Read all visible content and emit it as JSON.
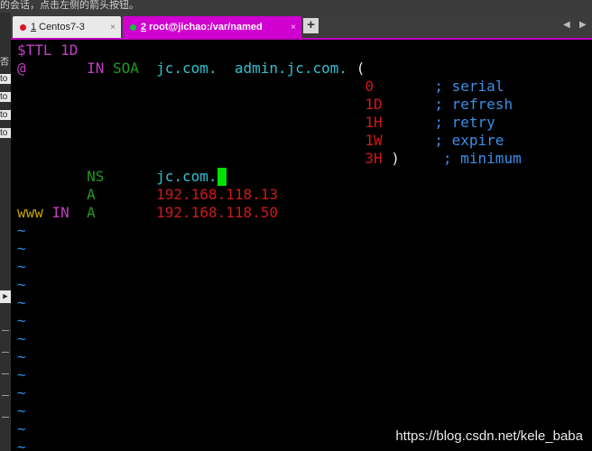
{
  "app_top_text": "的会话，点击左侧的箭头按钮。",
  "left_panel": {
    "items": [
      "否",
      "to",
      "to",
      "to",
      "to"
    ]
  },
  "tabs": [
    {
      "number": "1",
      "label": "Centos7-3",
      "status_color": "#e0102a",
      "active": false,
      "close": "×"
    },
    {
      "number": "2",
      "label": "root@jichao:/var/named",
      "status_color": "#17c13a",
      "active": true,
      "close": "×"
    }
  ],
  "add_tab_label": "+",
  "tab_nav": {
    "prev": "◀",
    "next": "▶"
  },
  "editor": {
    "lines": [
      {
        "segments": [
          {
            "text": "$TTL 1D",
            "color": "pink"
          }
        ]
      },
      {
        "segments": [
          {
            "text": "@",
            "color": "pink"
          },
          {
            "text": "       IN ",
            "color": "pink"
          },
          {
            "text": "SOA",
            "color": "green"
          },
          {
            "text": "  jc.com.  admin.jc.com. ",
            "color": "cyan"
          },
          {
            "text": "(",
            "color": "white"
          }
        ]
      },
      {
        "segments": [
          {
            "text": "                                        0",
            "color": "red"
          },
          {
            "text": "       ; serial",
            "color": "blue"
          }
        ]
      },
      {
        "segments": [
          {
            "text": "                                        1D",
            "color": "red"
          },
          {
            "text": "      ; refresh",
            "color": "blue"
          }
        ]
      },
      {
        "segments": [
          {
            "text": "                                        1H",
            "color": "red"
          },
          {
            "text": "      ; retry",
            "color": "blue"
          }
        ]
      },
      {
        "segments": [
          {
            "text": "                                        1W",
            "color": "red"
          },
          {
            "text": "      ; expire",
            "color": "blue"
          }
        ]
      },
      {
        "segments": [
          {
            "text": "                                        3H",
            "color": "red"
          },
          {
            "text": " )",
            "color": "white"
          },
          {
            "text": "     ; minimum",
            "color": "blue"
          }
        ]
      },
      {
        "segments": [
          {
            "text": "        NS",
            "color": "green"
          },
          {
            "text": "      jc.com.",
            "color": "cyan"
          },
          {
            "text": " ",
            "color": "cursor"
          }
        ]
      },
      {
        "segments": [
          {
            "text": "        A",
            "color": "green"
          },
          {
            "text": "       192.168.118.13",
            "color": "red"
          }
        ]
      },
      {
        "segments": [
          {
            "text": "www",
            "color": "yellow"
          },
          {
            "text": " IN",
            "color": "pink"
          },
          {
            "text": "  A",
            "color": "green"
          },
          {
            "text": "       192.168.118.50",
            "color": "red"
          }
        ]
      }
    ],
    "tilde_lines": [
      "~",
      "~",
      "~",
      "~",
      "~",
      "~",
      "~",
      "~",
      "~",
      "~",
      "~",
      "~",
      "~"
    ]
  },
  "watermark": "https://blog.csdn.net/kele_baba",
  "colors": {
    "active_tab": "#d000d0",
    "terminal_bg": "#000000",
    "cursor": "#00e000"
  }
}
